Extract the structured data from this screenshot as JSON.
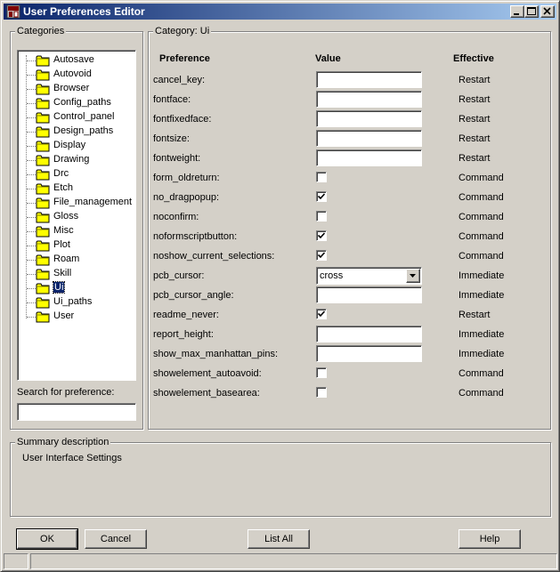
{
  "window": {
    "title": "User Preferences Editor"
  },
  "categories": {
    "group_label": "Categories",
    "items": [
      {
        "label": "Autosave"
      },
      {
        "label": "Autovoid"
      },
      {
        "label": "Browser"
      },
      {
        "label": "Config_paths"
      },
      {
        "label": "Control_panel"
      },
      {
        "label": "Design_paths"
      },
      {
        "label": "Display"
      },
      {
        "label": "Drawing"
      },
      {
        "label": "Drc"
      },
      {
        "label": "Etch"
      },
      {
        "label": "File_management"
      },
      {
        "label": "Gloss"
      },
      {
        "label": "Misc"
      },
      {
        "label": "Plot"
      },
      {
        "label": "Roam"
      },
      {
        "label": "Skill"
      },
      {
        "label": "Ui"
      },
      {
        "label": "Ui_paths"
      },
      {
        "label": "User"
      }
    ],
    "selected": "Ui",
    "search_label": "Search for preference:",
    "search_value": ""
  },
  "category_panel": {
    "group_label": "Category:  Ui",
    "headers": {
      "preference": "Preference",
      "value": "Value",
      "effective": "Effective"
    },
    "rows": [
      {
        "name": "cancel_key:",
        "type": "text",
        "value": "",
        "effective": "Restart"
      },
      {
        "name": "fontface:",
        "type": "text",
        "value": "",
        "effective": "Restart"
      },
      {
        "name": "fontfixedface:",
        "type": "text",
        "value": "",
        "effective": "Restart"
      },
      {
        "name": "fontsize:",
        "type": "text",
        "value": "",
        "effective": "Restart"
      },
      {
        "name": "fontweight:",
        "type": "text",
        "value": "",
        "effective": "Restart"
      },
      {
        "name": "form_oldreturn:",
        "type": "checkbox",
        "checked": false,
        "effective": "Command"
      },
      {
        "name": "no_dragpopup:",
        "type": "checkbox",
        "checked": true,
        "effective": "Command"
      },
      {
        "name": "noconfirm:",
        "type": "checkbox",
        "checked": false,
        "effective": "Command"
      },
      {
        "name": "noformscriptbutton:",
        "type": "checkbox",
        "checked": true,
        "effective": "Command"
      },
      {
        "name": "noshow_current_selections:",
        "type": "checkbox",
        "checked": true,
        "effective": "Command"
      },
      {
        "name": "pcb_cursor:",
        "type": "select",
        "value": "cross",
        "effective": "Immediate"
      },
      {
        "name": "pcb_cursor_angle:",
        "type": "text",
        "value": "",
        "effective": "Immediate"
      },
      {
        "name": "readme_never:",
        "type": "checkbox",
        "checked": true,
        "effective": "Restart"
      },
      {
        "name": "report_height:",
        "type": "text",
        "value": "",
        "effective": "Immediate"
      },
      {
        "name": "show_max_manhattan_pins:",
        "type": "text",
        "value": "",
        "effective": "Immediate"
      },
      {
        "name": "showelement_autoavoid:",
        "type": "checkbox",
        "checked": false,
        "effective": "Command"
      },
      {
        "name": "showelement_basearea:",
        "type": "checkbox",
        "checked": false,
        "effective": "Command"
      }
    ]
  },
  "summary": {
    "group_label": "Summary description",
    "text": "User Interface Settings"
  },
  "buttons": {
    "ok": "OK",
    "cancel": "Cancel",
    "list_all": "List All",
    "help": "Help"
  },
  "icons": {
    "app": "app-icon",
    "folder": "folder-icon",
    "minimize": "minimize-icon",
    "maximize": "maximize-icon",
    "close": "close-icon",
    "checkmark": "checkmark-icon",
    "dropdown": "chevron-down-icon"
  },
  "colors": {
    "titlebar_start": "#0a246a",
    "titlebar_end": "#a6caf0",
    "face": "#d4d0c8",
    "selection": "#0a246a",
    "folder": "#ffff00"
  }
}
